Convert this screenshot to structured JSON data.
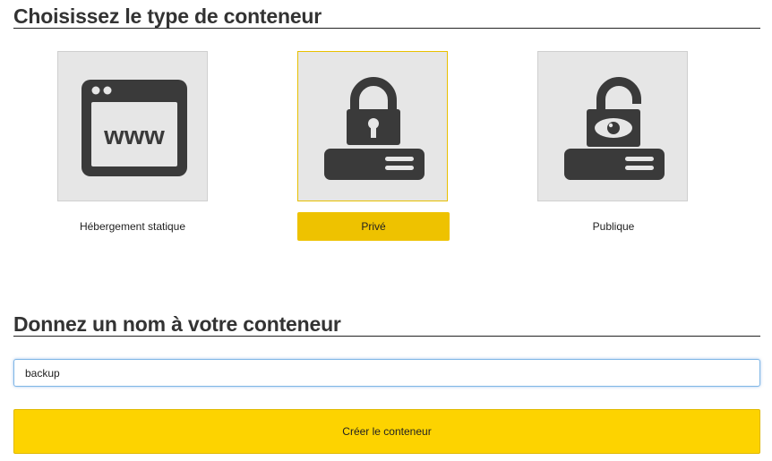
{
  "container_type": {
    "title": "Choisissez le type de conteneur",
    "options": [
      {
        "label": "Hébergement statique",
        "icon": "browser-www-icon",
        "selected": false
      },
      {
        "label": "Privé",
        "icon": "locked-padlock-server-icon",
        "selected": true
      },
      {
        "label": "Publique",
        "icon": "unlocked-padlock-eye-server-icon",
        "selected": false
      }
    ],
    "www_text": "www"
  },
  "container_name": {
    "title": "Donnez un nom à votre conteneur",
    "value": "backup",
    "placeholder": ""
  },
  "create_button": {
    "label": "Créer le conteneur"
  },
  "colors": {
    "accent": "#eec200",
    "button": "#fdd300",
    "icon": "#3a3a3a",
    "tile": "#e6e6e6"
  }
}
